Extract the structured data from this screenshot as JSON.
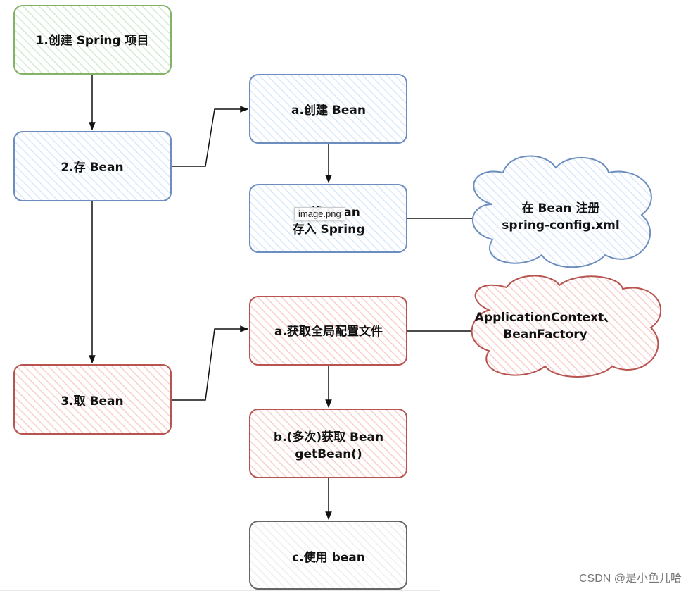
{
  "colors": {
    "green_stroke": "#82b366",
    "green_fill": "#d5e8d4",
    "blue_stroke": "#6c8ebf",
    "blue_fill": "#dae8fc",
    "red_stroke": "#b85450",
    "red_fill": "#f8cecc",
    "gray_stroke": "#666666",
    "gray_fill": "#f5f5f5"
  },
  "nodes": {
    "step1": "1.创建 Spring 项目",
    "step2": "2.存 Bean",
    "step3": "3.取 Bean",
    "store_a": "a.创建 Bean",
    "store_b_line1": "b.将 Bean",
    "store_b_line2": "存入 Spring",
    "cloud_store_line1": "在 Bean 注册",
    "cloud_store_line2": "spring-config.xml",
    "get_a": "a.获取全局配置文件",
    "cloud_get_line1": "ApplicationContext、",
    "cloud_get_line2": "BeanFactory",
    "get_b_line1": "b.(多次)获取 Bean",
    "get_b_line2": "getBean()",
    "get_c": "c.使用 bean"
  },
  "tooltip": "image.png",
  "watermark": "CSDN @是小鱼儿哈"
}
